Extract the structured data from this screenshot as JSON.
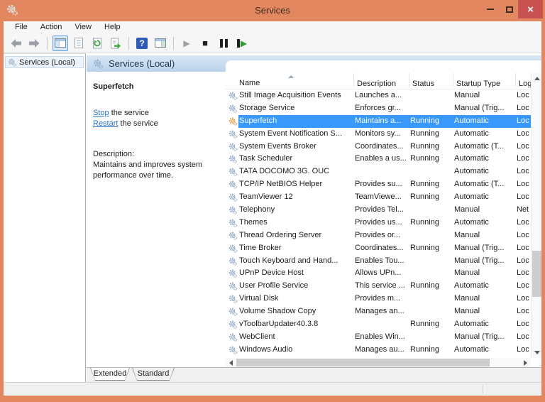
{
  "titlebar": {
    "title": "Services"
  },
  "menubar": {
    "items": [
      "File",
      "Action",
      "View",
      "Help"
    ]
  },
  "toolbar": {
    "help_glyph": "?",
    "play_glyph": "▶",
    "stop_glyph": "■",
    "restart_glyph": "▶"
  },
  "tree": {
    "root": "Services (Local)"
  },
  "band": {
    "title": "Services (Local)"
  },
  "info": {
    "name": "Superfetch",
    "stop_link": "Stop",
    "stop_suffix": " the service",
    "restart_link": "Restart",
    "restart_suffix": " the service",
    "desc_label": "Description:",
    "desc_text": "Maintains and improves system performance over time."
  },
  "table": {
    "headers": {
      "name": "Name",
      "description": "Description",
      "status": "Status",
      "startup": "Startup Type",
      "logon": "Log"
    },
    "rows": [
      {
        "name": "Still Image Acquisition Events",
        "description": "Launches a...",
        "status": "",
        "startup": "Manual",
        "logon": "Loc",
        "selected": false
      },
      {
        "name": "Storage Service",
        "description": "Enforces gr...",
        "status": "",
        "startup": "Manual (Trig...",
        "logon": "Loc",
        "selected": false
      },
      {
        "name": "Superfetch",
        "description": "Maintains a...",
        "status": "Running",
        "startup": "Automatic",
        "logon": "Loc",
        "selected": true
      },
      {
        "name": "System Event Notification S...",
        "description": "Monitors sy...",
        "status": "Running",
        "startup": "Automatic",
        "logon": "Loc",
        "selected": false
      },
      {
        "name": "System Events Broker",
        "description": "Coordinates...",
        "status": "Running",
        "startup": "Automatic (T...",
        "logon": "Loc",
        "selected": false
      },
      {
        "name": "Task Scheduler",
        "description": "Enables a us...",
        "status": "Running",
        "startup": "Automatic",
        "logon": "Loc",
        "selected": false
      },
      {
        "name": "TATA DOCOMO 3G. OUC",
        "description": "",
        "status": "",
        "startup": "Automatic",
        "logon": "Loc",
        "selected": false
      },
      {
        "name": "TCP/IP NetBIOS Helper",
        "description": "Provides su...",
        "status": "Running",
        "startup": "Automatic (T...",
        "logon": "Loc",
        "selected": false
      },
      {
        "name": "TeamViewer 12",
        "description": "TeamViewe...",
        "status": "Running",
        "startup": "Automatic",
        "logon": "Loc",
        "selected": false
      },
      {
        "name": "Telephony",
        "description": "Provides Tel...",
        "status": "",
        "startup": "Manual",
        "logon": "Net",
        "selected": false
      },
      {
        "name": "Themes",
        "description": "Provides us...",
        "status": "Running",
        "startup": "Automatic",
        "logon": "Loc",
        "selected": false
      },
      {
        "name": "Thread Ordering Server",
        "description": "Provides or...",
        "status": "",
        "startup": "Manual",
        "logon": "Loc",
        "selected": false
      },
      {
        "name": "Time Broker",
        "description": "Coordinates...",
        "status": "Running",
        "startup": "Manual (Trig...",
        "logon": "Loc",
        "selected": false
      },
      {
        "name": "Touch Keyboard and Hand...",
        "description": "Enables Tou...",
        "status": "",
        "startup": "Manual (Trig...",
        "logon": "Loc",
        "selected": false
      },
      {
        "name": "UPnP Device Host",
        "description": "Allows UPn...",
        "status": "",
        "startup": "Manual",
        "logon": "Loc",
        "selected": false
      },
      {
        "name": "User Profile Service",
        "description": "This service ...",
        "status": "Running",
        "startup": "Automatic",
        "logon": "Loc",
        "selected": false
      },
      {
        "name": "Virtual Disk",
        "description": "Provides m...",
        "status": "",
        "startup": "Manual",
        "logon": "Loc",
        "selected": false
      },
      {
        "name": "Volume Shadow Copy",
        "description": "Manages an...",
        "status": "",
        "startup": "Manual",
        "logon": "Loc",
        "selected": false
      },
      {
        "name": "vToolbarUpdater40.3.8",
        "description": "",
        "status": "Running",
        "startup": "Automatic",
        "logon": "Loc",
        "selected": false
      },
      {
        "name": "WebClient",
        "description": "Enables Win...",
        "status": "",
        "startup": "Manual (Trig...",
        "logon": "Loc",
        "selected": false
      },
      {
        "name": "Windows Audio",
        "description": "Manages au...",
        "status": "Running",
        "startup": "Automatic",
        "logon": "Loc",
        "selected": false
      }
    ]
  },
  "tabs": {
    "extended": "Extended",
    "standard": "Standard"
  },
  "colors": {
    "titlebar": "#e2875f",
    "close": "#c85250",
    "selection": "#3898fb",
    "link": "#2e70c0",
    "band_top": "#d9e7f5",
    "band_bottom": "#bad2ea"
  }
}
